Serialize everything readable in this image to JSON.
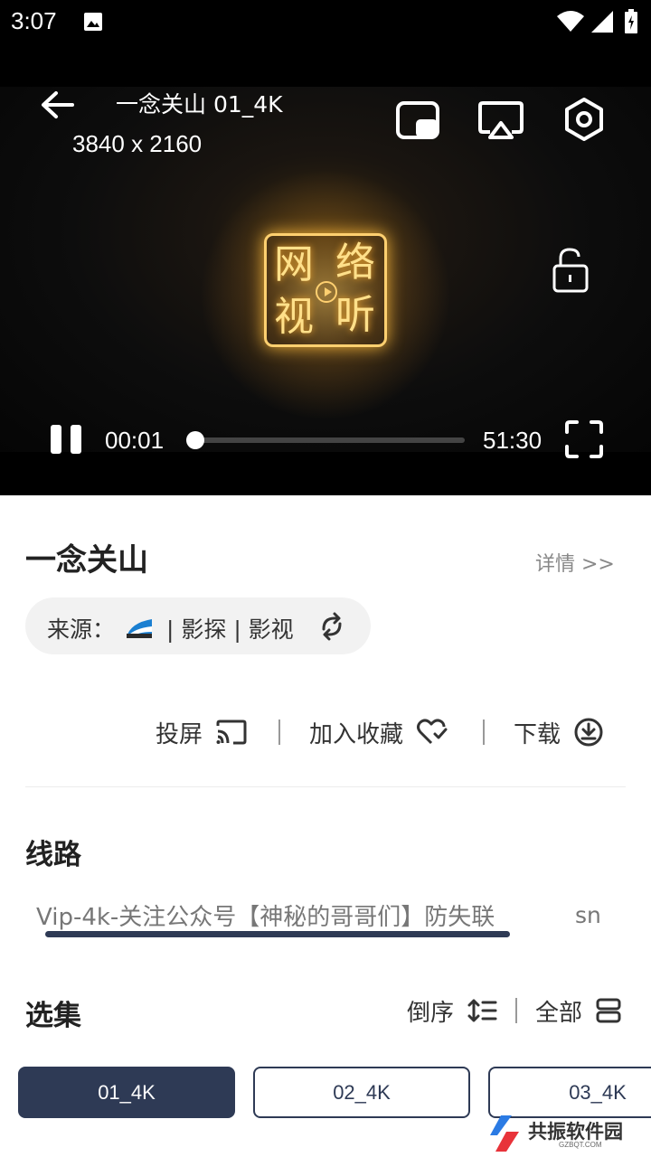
{
  "status_bar": {
    "time": "3:07"
  },
  "player": {
    "title": "一念关山 01_4K",
    "resolution": "3840 x 2160",
    "logo_glyphs": [
      "网",
      "络",
      "视",
      "听"
    ],
    "current_time": "00:01",
    "total_time": "51:30",
    "progress": 0.0003
  },
  "info": {
    "title": "一念关山",
    "details_link": "详情 >>",
    "source_label": "来源：",
    "source_name": "| 影探 | 影视"
  },
  "actions": {
    "cast": "投屏",
    "favorite": "加入收藏",
    "download": "下载"
  },
  "lines": {
    "title": "线路",
    "tabs": [
      "Vip-4k-关注公众号【神秘的哥哥们】防失联",
      "sn"
    ],
    "selected_index": 0
  },
  "episodes": {
    "title": "选集",
    "sort_label": "倒序",
    "all_label": "全部",
    "items": [
      "01_4K",
      "02_4K",
      "03_4K"
    ],
    "selected_index": 0
  },
  "watermark": {
    "text": "共振软件园",
    "sub": "GZBQT.COM"
  },
  "colors": {
    "accent": "#2e3a55",
    "pill_bg": "#f2f2f2",
    "player_bg": "#000000"
  }
}
